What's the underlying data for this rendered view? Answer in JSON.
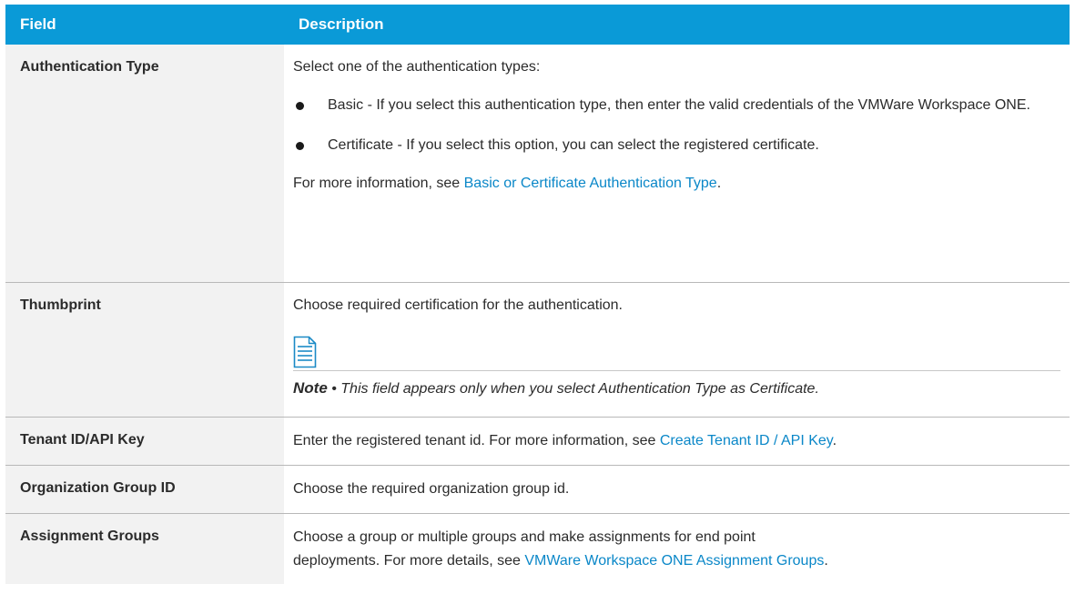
{
  "header": {
    "field": "Field",
    "description": "Description"
  },
  "rows": {
    "auth": {
      "field": "Authentication Type",
      "intro": "Select one of the authentication types:",
      "bullets": [
        "Basic - If you select this authentication type, then enter the valid credentials of the VMWare Workspace ONE.",
        "Certificate - If you select this option, you can select the registered certificate."
      ],
      "more_prefix": "For more information, see ",
      "more_link": "Basic or Certificate Authentication Type",
      "more_suffix": "."
    },
    "thumb": {
      "field": "Thumbprint",
      "text": "Choose required certification for the authentication.",
      "note_label": "Note",
      "note_sep": " • ",
      "note_text": "This field appears only when you select Authentication Type as Certificate."
    },
    "tenant": {
      "field": "Tenant ID/API Key",
      "text": "Enter the registered tenant id. For more information, see ",
      "link": "Create Tenant ID / API Key",
      "suffix": "."
    },
    "org": {
      "field": "Organization Group ID",
      "text": "Choose the required organization group id."
    },
    "assign": {
      "field": "Assignment Groups",
      "line1": "Choose a group or multiple groups and make assignments for end point",
      "line2": "deployments. For more details, see ",
      "link": "VMWare Workspace ONE Assignment Groups",
      "suffix": "."
    }
  },
  "icons": {
    "note": "document-icon"
  },
  "colors": {
    "header_bg": "#0a9ad7",
    "link": "#0a87c8",
    "field_bg": "#f2f2f2"
  }
}
